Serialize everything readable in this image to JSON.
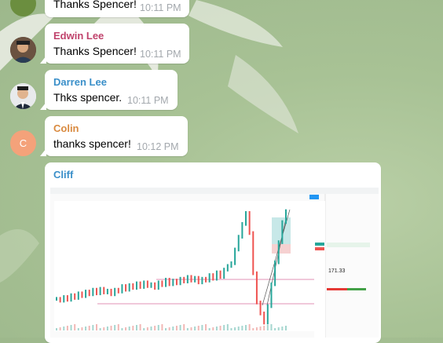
{
  "messages": [
    {
      "sender": "",
      "text": "Thanks Spencer!",
      "time": "10:11 PM"
    },
    {
      "sender": "Edwin Lee",
      "text": "Thanks Spencer!",
      "time": "10:11 PM",
      "color": "#c0436c"
    },
    {
      "sender": "Darren Lee",
      "text": "Thks spencer.",
      "time": "10:11 PM",
      "color": "#3a8fc9"
    },
    {
      "sender": "Colin",
      "text": "thanks spencer!",
      "time": "10:12 PM",
      "color": "#d98a3f",
      "avatar_initial": "C"
    },
    {
      "sender": "Cliff",
      "color": "#3a8fc9"
    }
  ],
  "avatar_colors": {
    "colin": "#f4a27a"
  },
  "chart_data": {
    "type": "line",
    "title": "",
    "series": [
      {
        "values": [
          56,
          54,
          58,
          55,
          60,
          57,
          62,
          59,
          64,
          61,
          66,
          62,
          67,
          63,
          65,
          61,
          66,
          64,
          70,
          66,
          71,
          68,
          73,
          69,
          74,
          70,
          72,
          68,
          74,
          71,
          77,
          72,
          76,
          73,
          78,
          75,
          80,
          76,
          79,
          74,
          78,
          76,
          82,
          78,
          85,
          80,
          88,
          92,
          95,
          110,
          124,
          138,
          150,
          128,
          84,
          52,
          40,
          30,
          48,
          72,
          96,
          118,
          140,
          152
        ]
      }
    ],
    "xlabel": "",
    "ylabel": ""
  }
}
